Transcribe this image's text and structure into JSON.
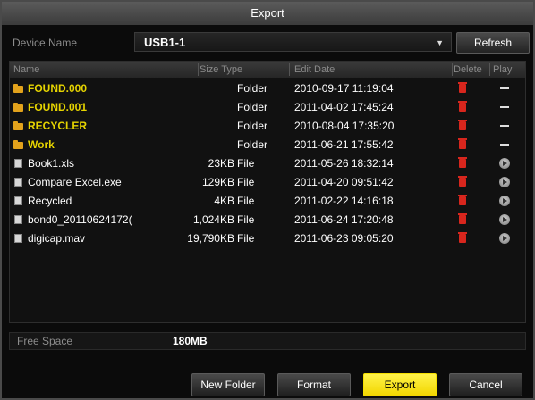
{
  "window": {
    "title": "Export"
  },
  "device": {
    "label": "Device Name",
    "value": "USB1-1",
    "refresh_label": "Refresh"
  },
  "columns": {
    "name": "Name",
    "size_type": "Size Type",
    "edit_date": "Edit Date",
    "delete": "Delete",
    "play": "Play"
  },
  "files": [
    {
      "name": "FOUND.000",
      "size": "",
      "type": "Folder",
      "date": "2010-09-17 11:19:04",
      "kind": "folder"
    },
    {
      "name": "FOUND.001",
      "size": "",
      "type": "Folder",
      "date": "2011-04-02 17:45:24",
      "kind": "folder"
    },
    {
      "name": "RECYCLER",
      "size": "",
      "type": "Folder",
      "date": "2010-08-04 17:35:20",
      "kind": "folder"
    },
    {
      "name": "Work",
      "size": "",
      "type": "Folder",
      "date": "2011-06-21 17:55:42",
      "kind": "folder"
    },
    {
      "name": "Book1.xls",
      "size": "23KB",
      "type": "File",
      "date": "2011-05-26 18:32:14",
      "kind": "file"
    },
    {
      "name": "Compare Excel.exe",
      "size": "129KB",
      "type": "File",
      "date": "2011-04-20 09:51:42",
      "kind": "file"
    },
    {
      "name": "Recycled",
      "size": "4KB",
      "type": "File",
      "date": "2011-02-22 14:16:18",
      "kind": "file"
    },
    {
      "name": "bond0_20110624172(",
      "size": "1,024KB",
      "type": "File",
      "date": "2011-06-24 17:20:48",
      "kind": "file"
    },
    {
      "name": "digicap.mav",
      "size": "19,790KB",
      "type": "File",
      "date": "2011-06-23 09:05:20",
      "kind": "file"
    }
  ],
  "free_space": {
    "label": "Free Space",
    "value": "180MB"
  },
  "buttons": {
    "new_folder": "New Folder",
    "format": "Format",
    "export": "Export",
    "cancel": "Cancel"
  },
  "icons": {
    "folder": "folder-icon",
    "file": "file-icon",
    "delete": "trash-icon",
    "play": "play-icon",
    "no_play": "dash-icon",
    "dropdown": "chevron-down-icon"
  },
  "colors": {
    "accent": "#f2d600",
    "folder_text": "#e6d400",
    "delete": "#d8261d"
  }
}
